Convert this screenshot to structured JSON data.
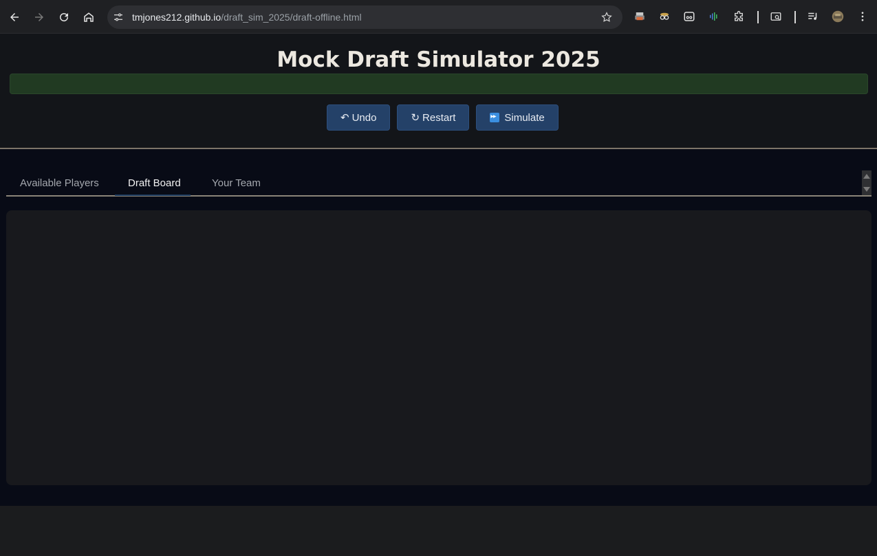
{
  "browser": {
    "url_host": "tmjones212.github.io",
    "url_path": "/draft_sim_2025/draft-offline.html"
  },
  "page": {
    "title": "Mock Draft Simulator 2025",
    "buttons": {
      "undo_icon": "↶",
      "undo_label": "Undo",
      "restart_icon": "↻",
      "restart_label": "Restart",
      "simulate_label": "Simulate"
    },
    "tabs": [
      {
        "label": "Available Players"
      },
      {
        "label": "Draft Board"
      },
      {
        "label": "Your Team"
      }
    ],
    "active_tab": "Draft Board"
  },
  "colors": {
    "accent_button": "#244168",
    "status_bar": "#213a22",
    "page_bg": "#080b16"
  }
}
